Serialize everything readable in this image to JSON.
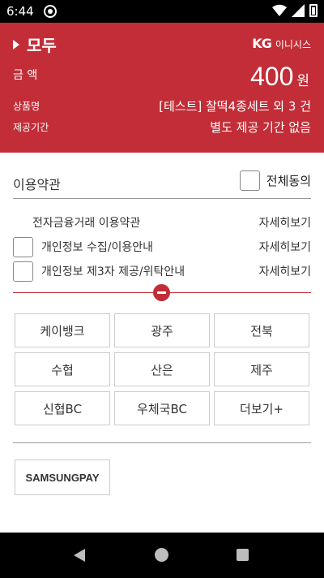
{
  "status_bar": {
    "time": "6:44"
  },
  "header": {
    "title": "모두",
    "logo_kg": "KG",
    "logo_name": "이니시스",
    "amount_label": "금 액",
    "amount_value": "400",
    "amount_unit": "원",
    "product_label": "상품명",
    "product_value": "[테스트] 찰떡4종세트 외 3 건",
    "period_label": "제공기간",
    "period_value": "별도 제공 기간 없음"
  },
  "terms": {
    "title": "이용약관",
    "agree_all": "전체동의",
    "items": [
      {
        "label": "전자금융거래 이용약관",
        "detail": "자세히보기"
      },
      {
        "label": "개인정보 수집/이용안내",
        "detail": "자세히보기"
      },
      {
        "label": "개인정보 제3자 제공/위탁안내",
        "detail": "자세히보기"
      }
    ]
  },
  "banks": [
    "케이뱅크",
    "광주",
    "전북",
    "수협",
    "산은",
    "제주",
    "신협BC",
    "우체국BC",
    "더보기+"
  ],
  "samsung_pay": "SAMSUNGPAY",
  "colors": {
    "brand_red": "#c22d37"
  }
}
